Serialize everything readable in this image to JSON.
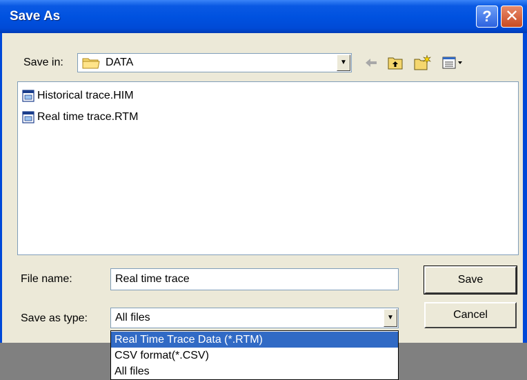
{
  "window": {
    "title": "Save As",
    "help_label": "?",
    "close_label": "✕"
  },
  "toolbar": {
    "save_in_label": "Save in:",
    "location": "DATA",
    "location_icon": "folder-icon",
    "tools": [
      "back-arrow-icon",
      "up-folder-icon",
      "new-folder-icon",
      "views-menu-icon"
    ]
  },
  "files": [
    {
      "name": "Historical trace.HIM",
      "icon": "trace-file-icon"
    },
    {
      "name": "Real time trace.RTM",
      "icon": "trace-file-icon"
    }
  ],
  "form": {
    "file_name_label": "File name:",
    "file_name_value": "Real time trace",
    "save_as_type_label": "Save as type:",
    "save_as_type_value": "All files"
  },
  "buttons": {
    "save": "Save",
    "cancel": "Cancel"
  },
  "dropdown": {
    "options": [
      "Real Time Trace Data (*.RTM)",
      "CSV format(*.CSV)",
      "All files"
    ],
    "highlighted_index": 0
  },
  "colors": {
    "titlebar": "#0052e0",
    "dialog_bg": "#ece9d8",
    "selection": "#316ac5"
  }
}
